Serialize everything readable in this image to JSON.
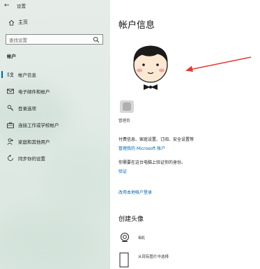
{
  "titlebar": {
    "back_glyph": "←",
    "title": "设置"
  },
  "sidebar": {
    "home_label": "主页",
    "search_placeholder": "查找设置",
    "section_label": "帐户",
    "items": [
      {
        "label": "帐户信息",
        "icon": "person-card-icon",
        "active": true
      },
      {
        "label": "电子邮件和帐户",
        "icon": "mail-icon",
        "active": false
      },
      {
        "label": "登录选项",
        "icon": "key-icon",
        "active": false
      },
      {
        "label": "连接工作或学校帐户",
        "icon": "briefcase-icon",
        "active": false
      },
      {
        "label": "家庭和其他用户",
        "icon": "person-add-icon",
        "active": false
      },
      {
        "label": "同步你的设置",
        "icon": "sync-icon",
        "active": false
      }
    ]
  },
  "main": {
    "title": "帐户信息",
    "account_role": "管理员",
    "billing_text": "付费信息、家庭设置、订阅、安全设置等",
    "manage_ms_link": "管理我的 Microsoft 帐户",
    "verify_text": "你需要在这台电脑上验证你的身份。",
    "verify_link": "验证",
    "local_account_link": "改用本地帐户登录",
    "create_avatar_heading": "创建头像",
    "camera_label": "相机",
    "browse_label": "从现有图片中选择"
  },
  "colors": {
    "accent": "#0063b1",
    "arrow": "#e53935"
  }
}
